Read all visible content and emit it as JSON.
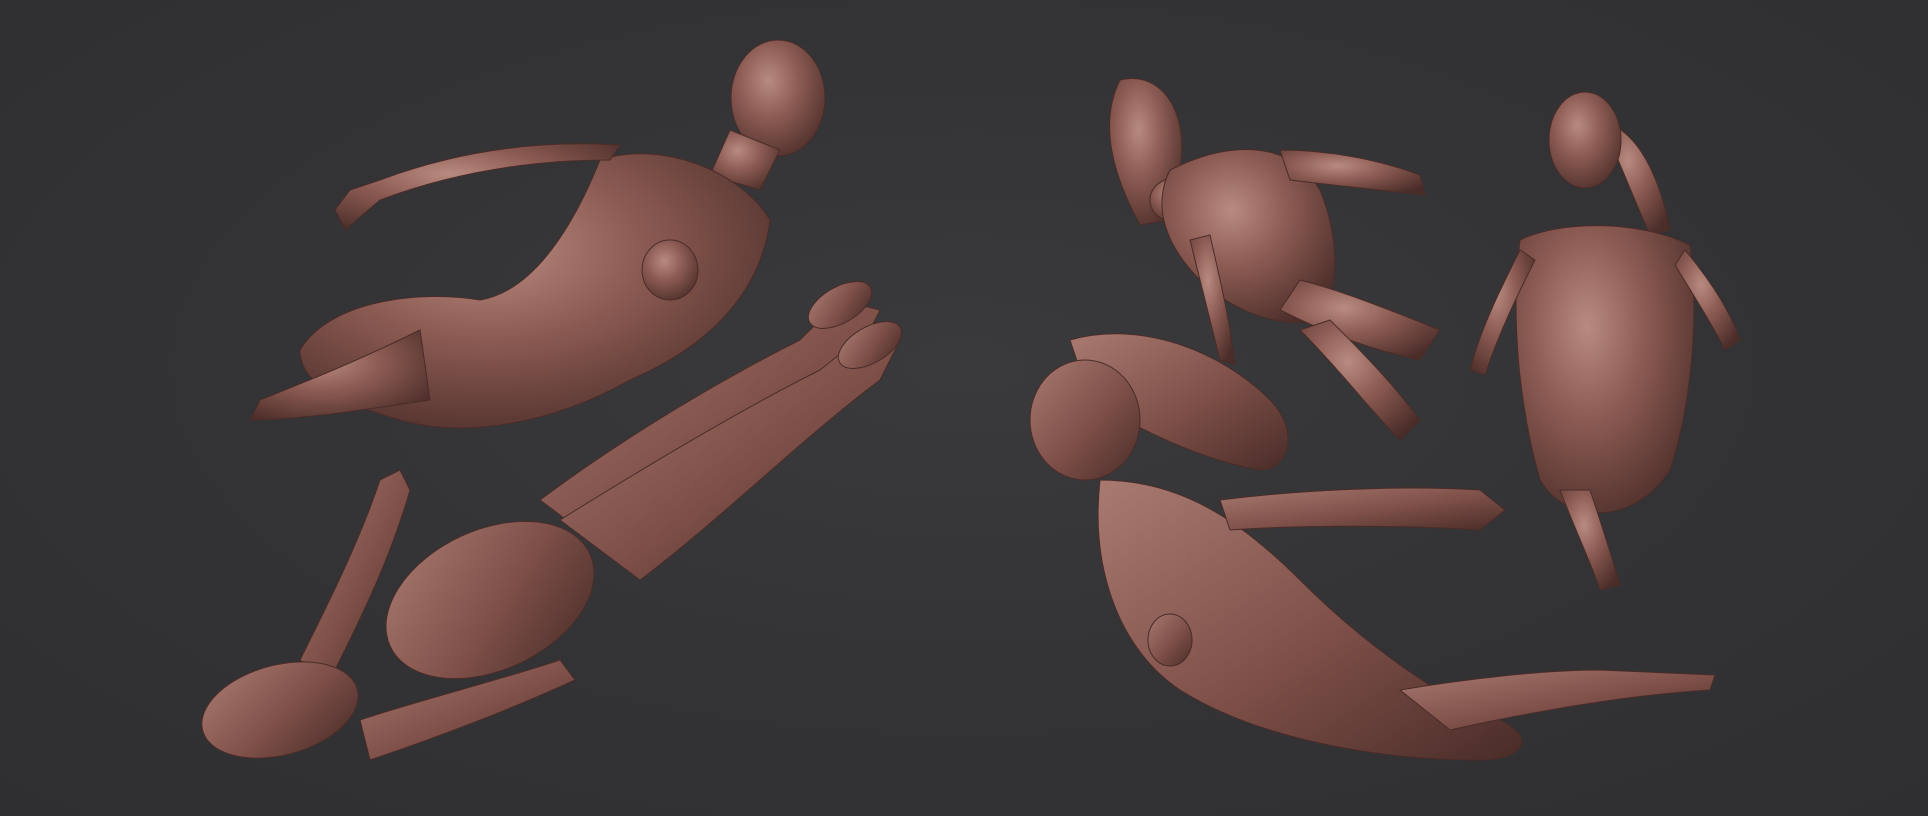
{
  "scene": {
    "background_color": "#333335",
    "clay_color": "#8a5a52",
    "clay_highlight": "#b98a80",
    "clay_shadow": "#4a2c28",
    "figures": [
      {
        "id": "figure-1",
        "pose": "flying-forward-side"
      },
      {
        "id": "figure-2",
        "pose": "diving-down-back"
      },
      {
        "id": "figure-3",
        "pose": "flying-back-view"
      },
      {
        "id": "figure-4",
        "pose": "flying-front-view"
      },
      {
        "id": "figure-5",
        "pose": "flying-side-reaching"
      }
    ]
  }
}
